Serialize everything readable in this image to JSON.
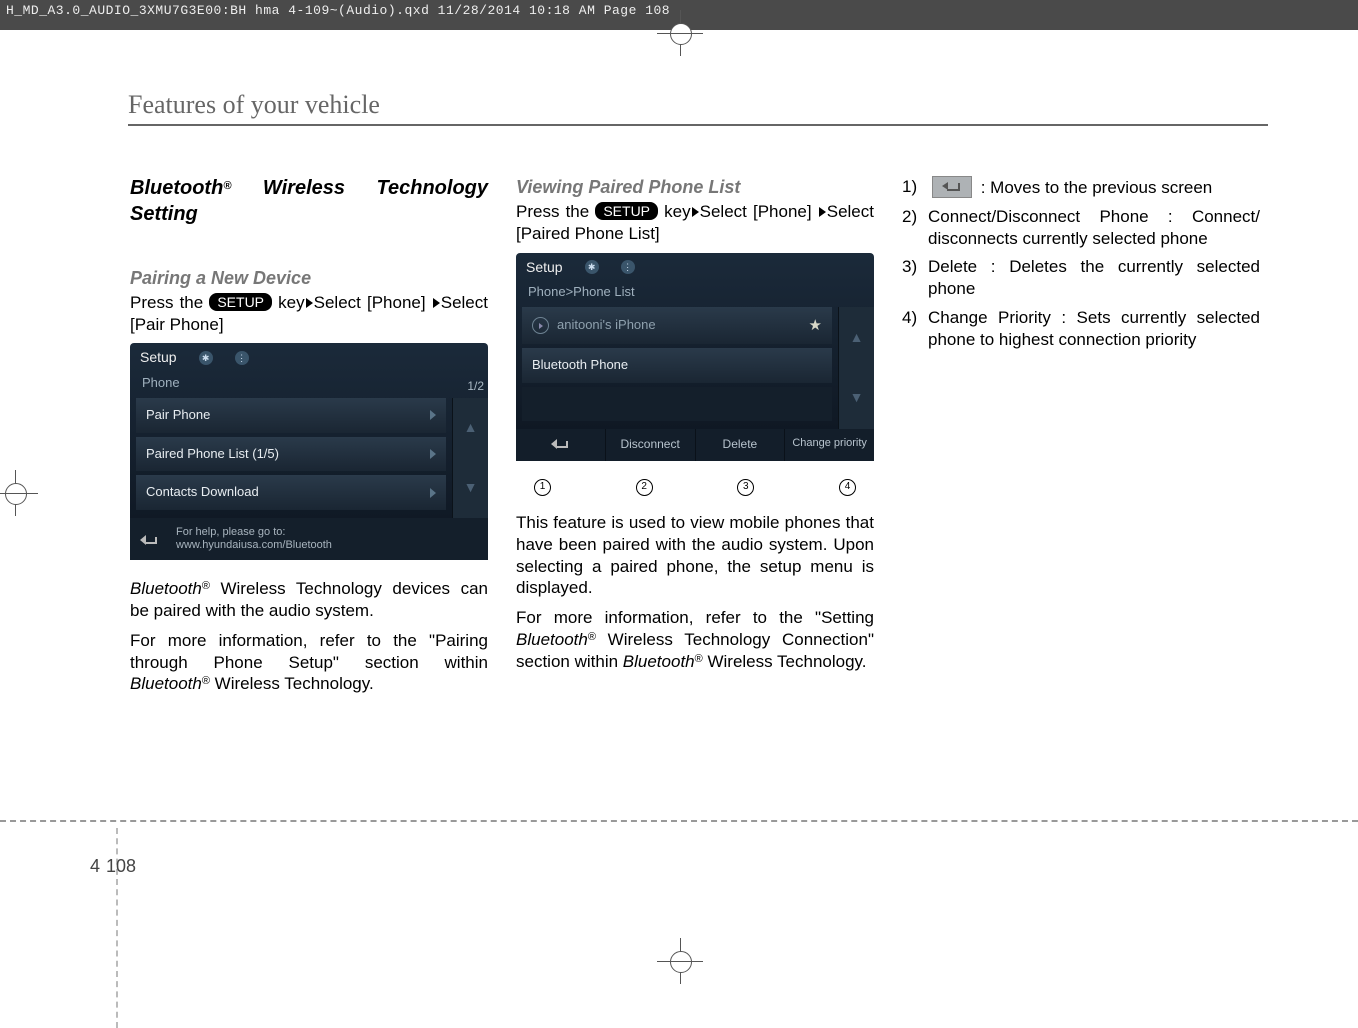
{
  "header_line": "H_MD_A3.0_AUDIO_3XMU7G3E00:BH hma 4-109~(Audio).qxd  11/28/2014  10:18 AM  Page 108",
  "section_title": "Features of your vehicle",
  "col1": {
    "heading_prefix": "Bluetooth",
    "heading_suffix": "  Wireless Technology Setting",
    "sub1": "Pairing a New Device",
    "press": "Press the ",
    "setup_label": "SETUP",
    "press_tail": " key",
    "select1": "Select [Phone] ",
    "select2": "Select [Pair Phone]",
    "img1": {
      "title": "Setup",
      "sub": "Phone",
      "page_count": "1/2",
      "rows": [
        "Pair Phone",
        "Paired Phone List (1/5)",
        "Contacts Download"
      ],
      "help1": "For help, please go to:",
      "help2": "www.hyundaiusa.com/Bluetooth"
    },
    "p1a": "Bluetooth",
    "p1b": " Wireless Technology devices can be paired with the audio system.",
    "p2a": "For more information, refer to the \"Pairing through Phone Setup\" section within ",
    "p2b": "Bluetooth",
    "p2c": " Wireless Technology."
  },
  "col2": {
    "sub": "Viewing Paired Phone List",
    "press": "Press the ",
    "setup_label": "SETUP",
    "press_tail": " key",
    "select1": "Select [Phone] ",
    "select2": "Select [Paired Phone List]",
    "img2": {
      "title": "Setup",
      "sub": "Phone>Phone List",
      "rows": [
        "anitooni's iPhone",
        "Bluetooth Phone"
      ],
      "buttons": [
        "Disconnect",
        "Delete",
        "Change priority"
      ]
    },
    "p1": "This feature is used to view mobile phones that have been paired with the audio system. Upon selecting a paired phone, the setup menu is displayed.",
    "p2a": "For more information, refer to the \"Setting ",
    "p2b": "Bluetooth",
    "p2c": " Wireless Technology Connection\" section within ",
    "p2d": "Bluetooth",
    "p2e": " Wireless Technology."
  },
  "col3": {
    "items": [
      {
        "n": "1)",
        "t": " : Moves to the previous screen",
        "has_icon": true
      },
      {
        "n": "2)",
        "t": "Connect/Disconnect Phone : Connect/ disconnects currently selected phone"
      },
      {
        "n": "3)",
        "t": "Delete : Deletes the currently selected phone"
      },
      {
        "n": "4)",
        "t": "Change Priority : Sets currently selected phone to highest connection priority"
      }
    ]
  },
  "page": {
    "chapter": "4",
    "number": "108"
  },
  "circled_nums": [
    "1",
    "2",
    "3",
    "4"
  ]
}
